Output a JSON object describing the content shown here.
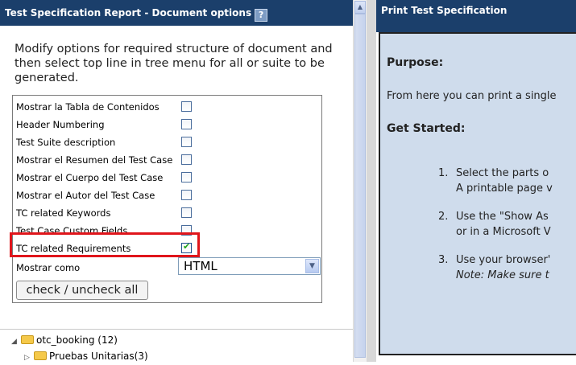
{
  "left_panel": {
    "title": "Test Specification Report - Document options",
    "intro": "Modify options for required structure of document and then select top line in tree menu for all or suite to be generated.",
    "options": [
      {
        "label": "Mostrar la Tabla de Contenidos",
        "checked": false
      },
      {
        "label": "Header Numbering",
        "checked": false
      },
      {
        "label": "Test Suite description",
        "checked": false
      },
      {
        "label": "Mostrar el Resumen del Test Case",
        "checked": false
      },
      {
        "label": "Mostrar el Cuerpo del Test Case",
        "checked": false
      },
      {
        "label": "Mostrar el Autor del Test Case",
        "checked": false
      },
      {
        "label": "TC related Keywords",
        "checked": false
      },
      {
        "label": "Test Case Custom Fields",
        "checked": false
      },
      {
        "label": "TC related Requirements",
        "checked": true
      }
    ],
    "format_label": "Mostrar como",
    "format_value": "HTML",
    "check_all_label": "check / uncheck all",
    "tree": [
      {
        "label": "otc_booking (12)"
      },
      {
        "label": "Pruebas Unitarias(3)"
      }
    ]
  },
  "right_panel": {
    "title": "Print Test Specification",
    "purpose_heading": "Purpose:",
    "purpose_text": "From here you can print a single",
    "get_started_heading": "Get Started:",
    "steps": [
      {
        "number": "1.",
        "line1": "Select the parts o",
        "line2": "A printable page v"
      },
      {
        "number": "2.",
        "line1": "Use the \"Show As",
        "line2": "or in a Microsoft V"
      },
      {
        "number": "3.",
        "line1": "Use your browser'",
        "line2": "Note: Make sure t"
      }
    ]
  },
  "colors": {
    "title_bar": "#1b3f6b",
    "right_content_bg": "#cfdcec",
    "highlight": "#e0151b",
    "check_tick": "#22a51a"
  }
}
